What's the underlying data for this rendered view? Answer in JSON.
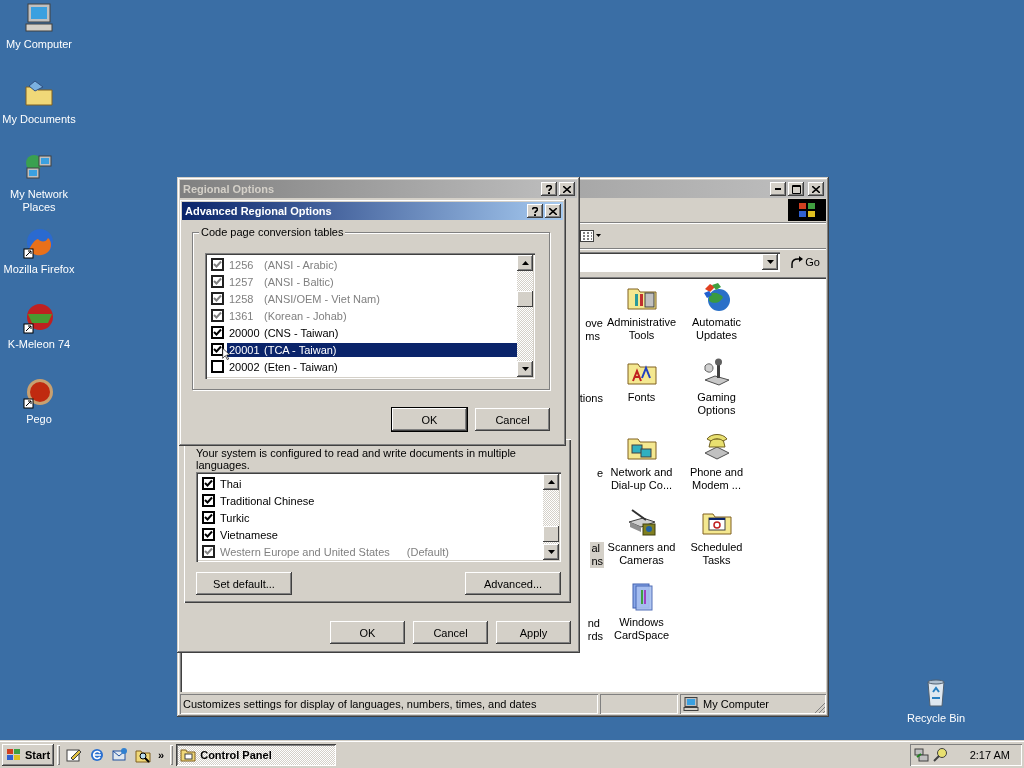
{
  "desktop_icons": [
    {
      "kind": "computer",
      "label": "My Computer"
    },
    {
      "kind": "documents",
      "label": "My Documents"
    },
    {
      "kind": "network",
      "label": "My Network Places"
    },
    {
      "kind": "firefox",
      "label": "Mozilla Firefox"
    },
    {
      "kind": "kmeleon",
      "label": "K-Meleon 74"
    },
    {
      "kind": "pego",
      "label": "Pego"
    },
    {
      "kind": "recycle",
      "label": "Recycle Bin"
    }
  ],
  "control_panel": {
    "go_button": "Go",
    "items": [
      {
        "kind": "partial",
        "lines": [
          "ove",
          "ms"
        ],
        "selected": false
      },
      {
        "kind": "admin",
        "lines": [
          "Administrative",
          "Tools"
        ],
        "selected": false
      },
      {
        "kind": "updates",
        "lines": [
          "Automatic",
          "Updates"
        ],
        "selected": false
      },
      {
        "kind": "partial",
        "lines": [
          "tions"
        ],
        "selected": false
      },
      {
        "kind": "fonts",
        "lines": [
          "Fonts"
        ],
        "selected": false
      },
      {
        "kind": "gaming",
        "lines": [
          "Gaming",
          "Options"
        ],
        "selected": false
      },
      {
        "kind": "partial",
        "lines": [
          "e"
        ],
        "selected": false
      },
      {
        "kind": "network",
        "lines": [
          "Network and",
          "Dial-up Co..."
        ],
        "selected": false
      },
      {
        "kind": "phone",
        "lines": [
          "Phone and",
          "Modem ..."
        ],
        "selected": false
      },
      {
        "kind": "partial",
        "lines": [
          "al",
          "ns"
        ],
        "selected": true
      },
      {
        "kind": "scanner",
        "lines": [
          "Scanners and",
          "Cameras"
        ],
        "selected": false
      },
      {
        "kind": "tasks",
        "lines": [
          "Scheduled",
          "Tasks"
        ],
        "selected": false
      },
      {
        "kind": "partial",
        "lines": [
          "nd",
          "rds"
        ],
        "selected": false
      },
      {
        "kind": "cardspace",
        "lines": [
          "Windows",
          "CardSpace"
        ],
        "selected": false
      }
    ],
    "status_bar": {
      "text": "Customizes settings for display of languages, numbers, times, and dates",
      "zone": "My Computer"
    }
  },
  "regional_options": {
    "title": "Regional Options",
    "intro": "Your system is configured to read and write documents in multiple languages.",
    "languages": [
      {
        "label": "Thai",
        "checked": true,
        "disabled": false
      },
      {
        "label": "Traditional Chinese",
        "checked": true,
        "disabled": false
      },
      {
        "label": "Turkic",
        "checked": true,
        "disabled": false
      },
      {
        "label": "Vietnamese",
        "checked": true,
        "disabled": false
      },
      {
        "label": "Western Europe and United States",
        "note": "(Default)",
        "checked": true,
        "disabled": true
      }
    ],
    "set_default_button": "Set default...",
    "advanced_button": "Advanced...",
    "footer_buttons": [
      "OK",
      "Cancel",
      "Apply"
    ]
  },
  "advanced_dialog": {
    "title": "Advanced Regional Options",
    "group_label": "Code page conversion tables",
    "code_pages": [
      {
        "code": "1256",
        "name": "(ANSI - Arabic)",
        "checked": true,
        "disabled": true,
        "selected": false
      },
      {
        "code": "1257",
        "name": "(ANSI - Baltic)",
        "checked": true,
        "disabled": true,
        "selected": false
      },
      {
        "code": "1258",
        "name": "(ANSI/OEM - Viet Nam)",
        "checked": true,
        "disabled": true,
        "selected": false
      },
      {
        "code": "1361",
        "name": "(Korean - Johab)",
        "checked": true,
        "disabled": true,
        "selected": false
      },
      {
        "code": "20000",
        "name": "(CNS - Taiwan)",
        "checked": true,
        "disabled": false,
        "selected": false
      },
      {
        "code": "20001",
        "name": "(TCA - Taiwan)",
        "checked": true,
        "disabled": false,
        "selected": true
      },
      {
        "code": "20002",
        "name": "(Eten - Taiwan)",
        "checked": false,
        "disabled": false,
        "selected": false
      }
    ],
    "buttons": [
      "OK",
      "Cancel"
    ]
  },
  "taskbar": {
    "start": "Start",
    "more": "»",
    "tasks": [
      {
        "label": "Control Panel",
        "selected": true
      }
    ],
    "clock": "2:17 AM"
  }
}
